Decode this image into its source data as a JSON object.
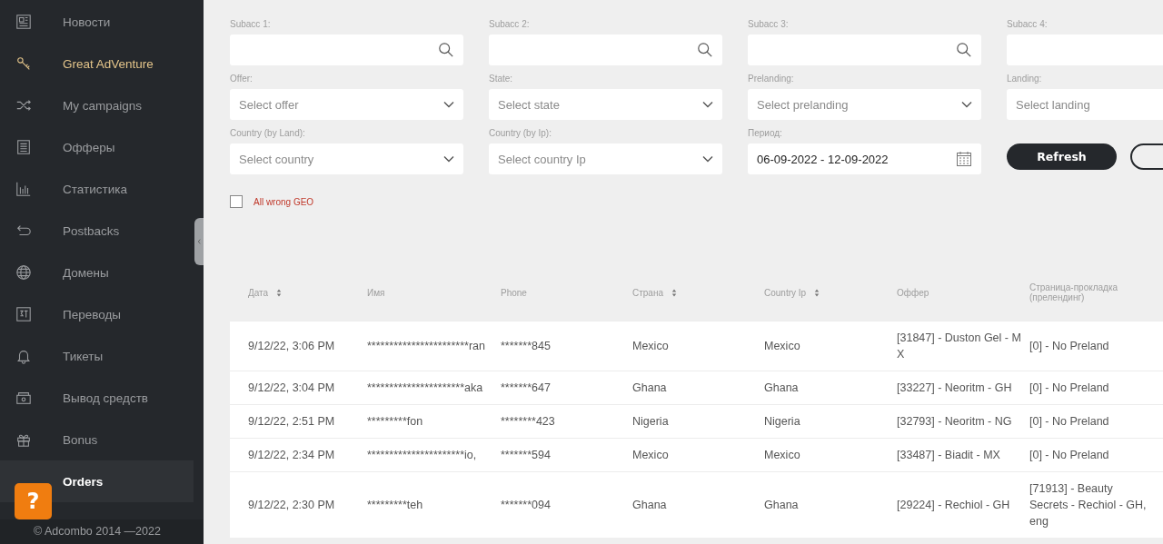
{
  "sidebar": {
    "items": [
      {
        "label": "Новости",
        "kind": "link",
        "selected": false
      },
      {
        "label": "Great AdVenture",
        "kind": "promo",
        "selected": false
      },
      {
        "label": "My campaigns",
        "kind": "link",
        "selected": false
      },
      {
        "label": "Офферы",
        "kind": "link",
        "selected": false
      },
      {
        "label": "Статистика",
        "kind": "link",
        "selected": false
      },
      {
        "label": "Postbacks",
        "kind": "link",
        "selected": false
      },
      {
        "label": "Домены",
        "kind": "link",
        "selected": false
      },
      {
        "label": "Переводы",
        "kind": "link",
        "selected": false
      },
      {
        "label": "Тикеты",
        "kind": "link",
        "selected": false
      },
      {
        "label": "Вывод средств",
        "kind": "link",
        "selected": false
      },
      {
        "label": "Bonus",
        "kind": "link",
        "selected": false
      },
      {
        "label": "Orders",
        "kind": "link",
        "selected": true
      }
    ],
    "help_button": "?",
    "footer": "© Adcombo 2014 —2022"
  },
  "filters": {
    "columns": [
      [
        {
          "kind": "search",
          "label": "Subacc 1:"
        },
        {
          "kind": "select",
          "label": "Offer:",
          "placeholder": "Select offer"
        },
        {
          "kind": "select",
          "label": "Country (by Land):",
          "placeholder": "Select country"
        }
      ],
      [
        {
          "kind": "search",
          "label": "Subacc 2:"
        },
        {
          "kind": "select",
          "label": "State:",
          "placeholder": "Select state"
        },
        {
          "kind": "select",
          "label": "Country (by Ip):",
          "placeholder": "Select country Ip"
        }
      ],
      [
        {
          "kind": "search",
          "label": "Subacc 3:"
        },
        {
          "kind": "select",
          "label": "Prelanding:",
          "placeholder": "Select prelanding"
        },
        {
          "kind": "date",
          "label": "Период:",
          "value": "06-09-2022 - 12-09-2022"
        }
      ],
      [
        {
          "kind": "search",
          "label": "Subacc 4:"
        },
        {
          "kind": "select",
          "label": "Landing:",
          "placeholder": "Select landing"
        },
        {
          "kind": "buttons",
          "primary": "Refresh"
        }
      ]
    ],
    "wrong_geo": {
      "label": "All wrong GEO",
      "checked": false
    }
  },
  "table": {
    "columns": [
      {
        "label": "Дата",
        "sortable": true
      },
      {
        "label": "Имя",
        "sortable": false
      },
      {
        "label": "Phone",
        "sortable": false
      },
      {
        "label": "Страна",
        "sortable": true
      },
      {
        "label": "Country Ip",
        "sortable": true
      },
      {
        "label": "Оффер",
        "sortable": false
      },
      {
        "label": "Страница-прокладка (прелендинг)",
        "sortable": false
      }
    ],
    "rows": [
      [
        "9/12/22, 3:06 PM",
        "***********************ran",
        "*******845",
        "Mexico",
        "Mexico",
        "[31847] - Duston Gel - MX",
        "[0] - No Preland"
      ],
      [
        "9/12/22, 3:04 PM",
        "**********************aka",
        "*******647",
        "Ghana",
        "Ghana",
        "[33227] - Neoritm - GH",
        "[0] - No Preland"
      ],
      [
        "9/12/22, 2:51 PM",
        "*********fon",
        "********423",
        "Nigeria",
        "Nigeria",
        "[32793] - Neoritm - NG",
        "[0] - No Preland"
      ],
      [
        "9/12/22, 2:34 PM",
        "**********************io,",
        "*******594",
        "Mexico",
        "Mexico",
        "[33487] - Biadit - MX",
        "[0] - No Preland"
      ],
      [
        "9/12/22, 2:30 PM",
        "*********teh",
        "*******094",
        "Ghana",
        "Ghana",
        "[29224] - Rechiol - GH",
        "[71913] - Beauty Secrets - Rechiol - GH, eng"
      ]
    ]
  }
}
